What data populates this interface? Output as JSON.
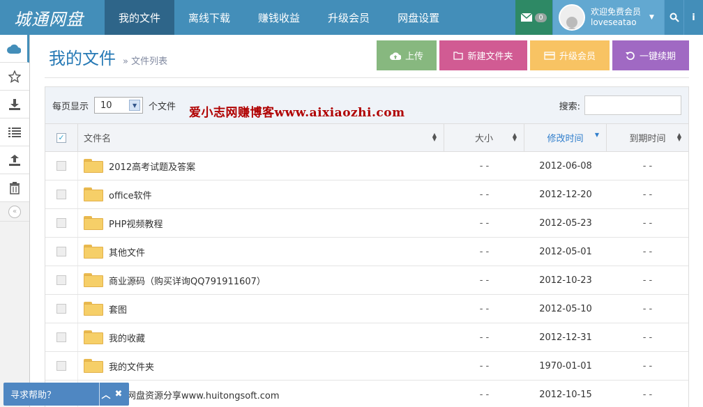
{
  "brand": {
    "name": "城通网盘"
  },
  "nav": {
    "items": [
      {
        "label": "我的文件",
        "active": true
      },
      {
        "label": "离线下载",
        "active": false
      },
      {
        "label": "赚钱收益",
        "active": false
      },
      {
        "label": "升级会员",
        "active": false
      },
      {
        "label": "网盘设置",
        "active": false
      }
    ],
    "messages": {
      "count": "0"
    },
    "user": {
      "greeting": "欢迎免费会员",
      "username": "loveseatao"
    }
  },
  "page": {
    "title": "我的文件",
    "breadcrumb": "» 文件列表"
  },
  "actions": {
    "upload": "上传",
    "new_folder": "新建文件夹",
    "upgrade": "升级会员",
    "renew": "一键续期"
  },
  "toolbar": {
    "per_page_label": "每页显示",
    "per_page_value": "10",
    "per_page_suffix": "个文件",
    "watermark": "爱小志网赚博客www.aixiaozhi.com",
    "search_label": "搜索:"
  },
  "table": {
    "headers": {
      "name": "文件名",
      "size": "大小",
      "modified": "修改时间",
      "expires": "到期时间"
    },
    "rows": [
      {
        "name": "2012高考试题及答案",
        "size": "- -",
        "modified": "2012-06-08",
        "expires": "- -"
      },
      {
        "name": "office软件",
        "size": "- -",
        "modified": "2012-12-20",
        "expires": "- -"
      },
      {
        "name": "PHP视频教程",
        "size": "- -",
        "modified": "2012-05-23",
        "expires": "- -"
      },
      {
        "name": "其他文件",
        "size": "- -",
        "modified": "2012-05-01",
        "expires": "- -"
      },
      {
        "name": "商业源码（购买详询QQ791911607）",
        "size": "- -",
        "modified": "2012-10-23",
        "expires": "- -"
      },
      {
        "name": "套图",
        "size": "- -",
        "modified": "2012-05-10",
        "expires": "- -"
      },
      {
        "name": "我的收藏",
        "size": "- -",
        "modified": "2012-12-31",
        "expires": "- -"
      },
      {
        "name": "我的文件夹",
        "size": "- -",
        "modified": "1970-01-01",
        "expires": "- -"
      },
      {
        "name": "汇通网盘资源分享www.huitongsoft.com",
        "size": "- -",
        "modified": "2012-10-15",
        "expires": "- -"
      }
    ]
  },
  "help": {
    "label": "寻求帮助？"
  }
}
